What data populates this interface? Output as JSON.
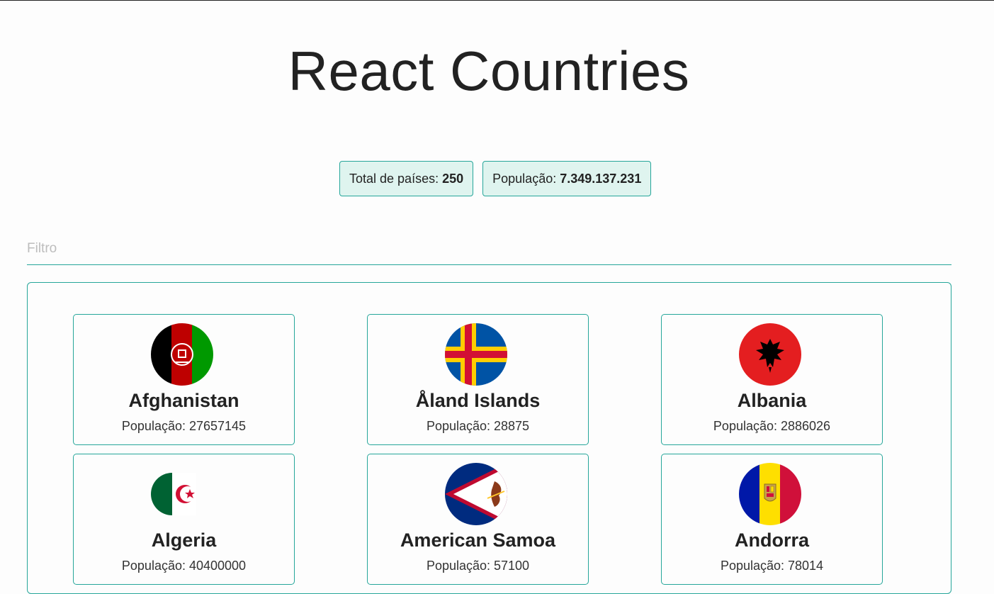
{
  "header": {
    "title": "React Countries"
  },
  "stats": {
    "total_label": "Total de países:",
    "total_value": "250",
    "population_label": "População:",
    "population_value": "7.349.137.231"
  },
  "filter": {
    "placeholder": "Filtro",
    "value": ""
  },
  "countries": [
    {
      "name": "Afghanistan",
      "population": "População: 27657145",
      "flag_icon": "afghanistan-flag-icon"
    },
    {
      "name": "Åland Islands",
      "population": "População: 28875",
      "flag_icon": "aland-islands-flag-icon"
    },
    {
      "name": "Albania",
      "population": "População: 2886026",
      "flag_icon": "albania-flag-icon"
    },
    {
      "name": "Algeria",
      "population": "População: 40400000",
      "flag_icon": "algeria-flag-icon"
    },
    {
      "name": "American Samoa",
      "population": "População: 57100",
      "flag_icon": "american-samoa-flag-icon"
    },
    {
      "name": "Andorra",
      "population": "População: 78014",
      "flag_icon": "andorra-flag-icon"
    }
  ],
  "colors": {
    "accent": "#26a69a",
    "badge_bg": "#dff4ef"
  }
}
